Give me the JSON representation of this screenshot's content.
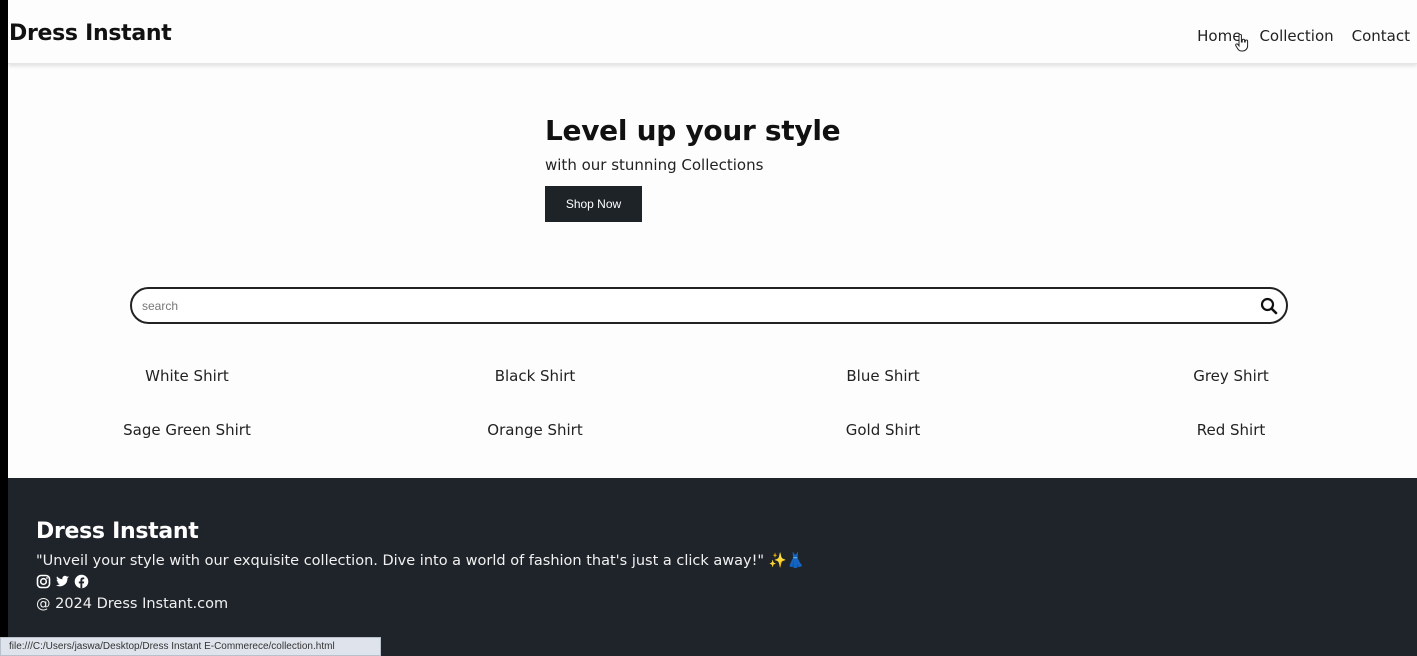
{
  "header": {
    "logo": "Dress Instant",
    "nav": [
      "Home",
      "Collection",
      "Contact"
    ]
  },
  "hero": {
    "title": "Level up your style",
    "subtitle": "with our stunning Collections",
    "button": "Shop Now"
  },
  "search": {
    "placeholder": "search",
    "value": ""
  },
  "products": [
    "White Shirt",
    "Black Shirt",
    "Blue Shirt",
    "Grey Shirt",
    "Sage Green Shirt",
    "Orange Shirt",
    "Gold Shirt",
    "Red Shirt"
  ],
  "footer": {
    "title": "Dress Instant",
    "quote": "\"Unveil your style with our exquisite collection. Dive into a world of fashion that's just a click away!\" ✨👗",
    "social_icons": [
      "instagram-icon",
      "twitter-icon",
      "facebook-icon"
    ],
    "copyright": "@ 2024 Dress Instant.com"
  },
  "status_bar": {
    "url": "file:///C:/Users/jaswa/Desktop/Dress Instant E-Commerece/collection.html"
  },
  "colors": {
    "footer_bg": "#1f242a",
    "button_bg": "#1e2328",
    "page_bg": "#fdfdfd"
  }
}
